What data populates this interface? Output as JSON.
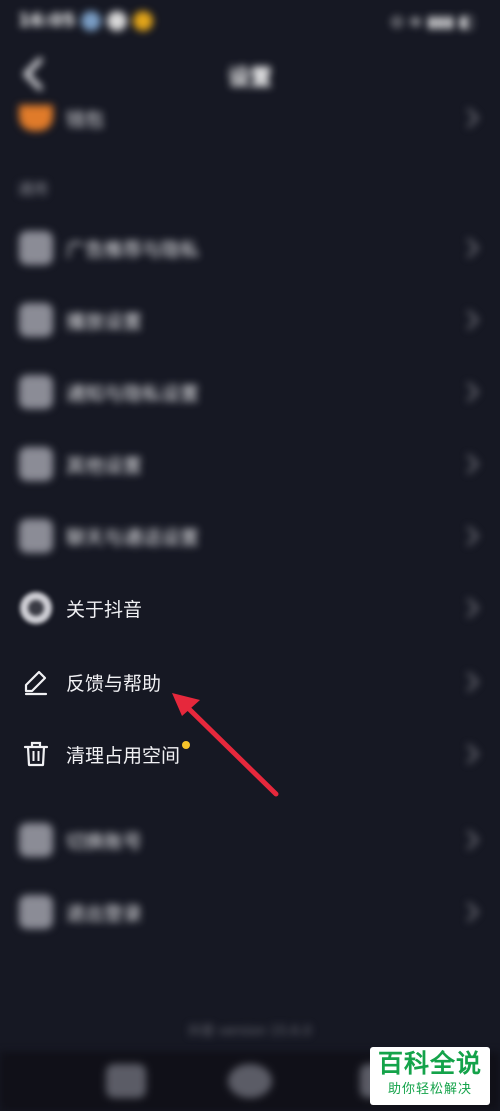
{
  "status_bar": {
    "time": "16:05",
    "right_text": "⊙ ≋ ▮▮▮ ◧"
  },
  "nav": {
    "title": "设置"
  },
  "rows_top": [
    {
      "label": "钱包"
    }
  ],
  "section": {
    "label": "通用"
  },
  "rows": [
    {
      "label": "广告推荐与隐私",
      "icon": "blurred-icon",
      "blurred": true
    },
    {
      "label": "播放设置",
      "icon": "blurred-icon",
      "blurred": true
    },
    {
      "label": "通知与隐私设置",
      "icon": "blurred-icon",
      "blurred": true
    },
    {
      "label": "其他设置",
      "icon": "blurred-icon",
      "blurred": true
    },
    {
      "label": "聊天与通话设置",
      "icon": "blurred-icon",
      "blurred": true
    },
    {
      "label": "关于抖音",
      "icon": "about-icon",
      "blurred": false
    },
    {
      "label": "反馈与帮助",
      "icon": "pencil-icon",
      "blurred": false
    },
    {
      "label": "清理占用空间",
      "icon": "trash-icon",
      "blurred": false
    },
    {
      "label": "切换账号",
      "icon": "blurred-icon",
      "blurred": true
    },
    {
      "label": "退出登录",
      "icon": "blurred-icon",
      "blurred": true
    }
  ],
  "footer": {
    "text": "抖音 version 15.6.0"
  },
  "watermark": {
    "title": "百科全说",
    "subtitle": "助你轻松解决"
  },
  "colors": {
    "background": "#161823",
    "arrow": "#e6283c",
    "dot": "#f6c32a",
    "watermark": "#14a34a"
  }
}
